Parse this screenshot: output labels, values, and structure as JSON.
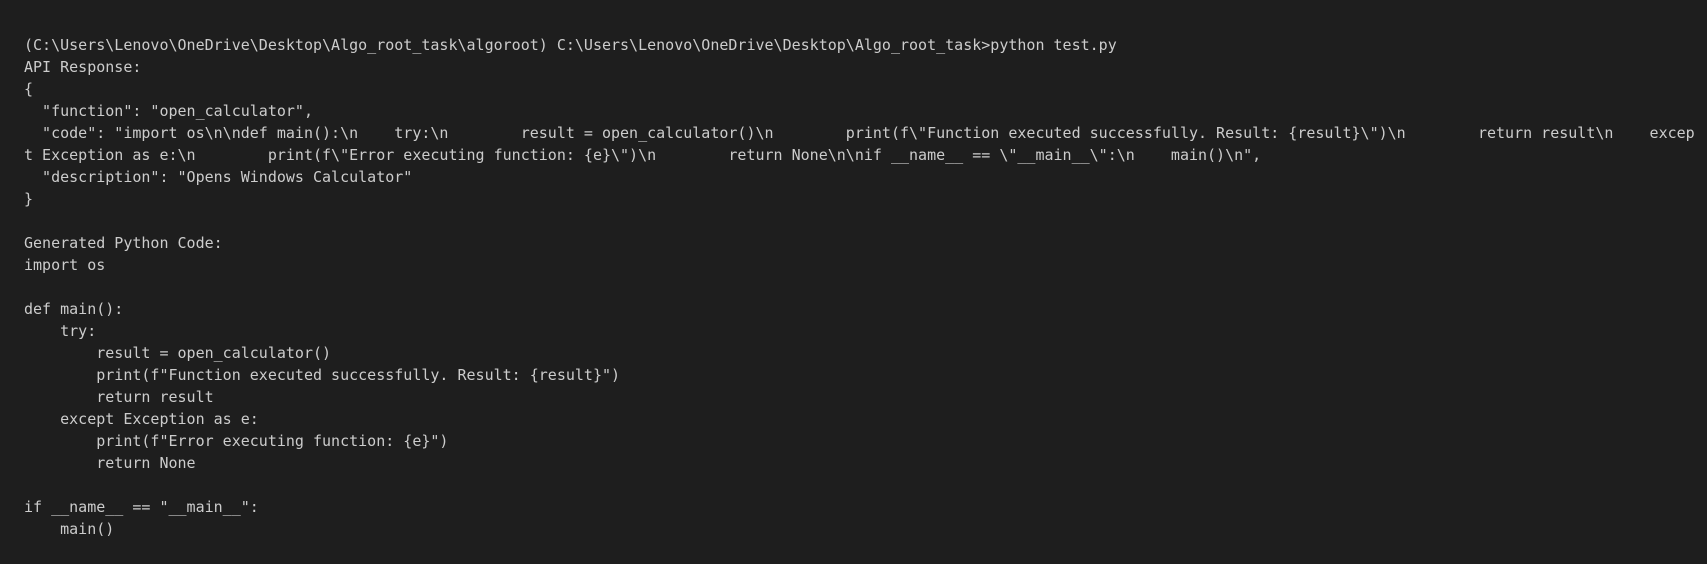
{
  "terminal": {
    "background": "#1e1e1e",
    "foreground": "#cccccc",
    "lines": [
      "(C:\\Users\\Lenovo\\OneDrive\\Desktop\\Algo_root_task\\algoroot) C:\\Users\\Lenovo\\OneDrive\\Desktop\\Algo_root_task>python test.py",
      "API Response:",
      "{",
      "  \"function\": \"open_calculator\",",
      "  \"code\": \"import os\\n\\ndef main():\\n    try:\\n        result = open_calculator()\\n        print(f\\\"Function executed successfully. Result: {result}\\\")\\n        return result\\n    excep",
      "t Exception as e:\\n        print(f\\\"Error executing function: {e}\\\")\\n        return None\\n\\nif __name__ == \\\"__main__\\\":\\n    main()\\n\",",
      "  \"description\": \"Opens Windows Calculator\"",
      "}",
      "",
      "Generated Python Code:",
      "import os",
      "",
      "def main():",
      "    try:",
      "        result = open_calculator()",
      "        print(f\"Function executed successfully. Result: {result}\")",
      "        return result",
      "    except Exception as e:",
      "        print(f\"Error executing function: {e}\")",
      "        return None",
      "",
      "if __name__ == \"__main__\":",
      "    main()"
    ]
  }
}
